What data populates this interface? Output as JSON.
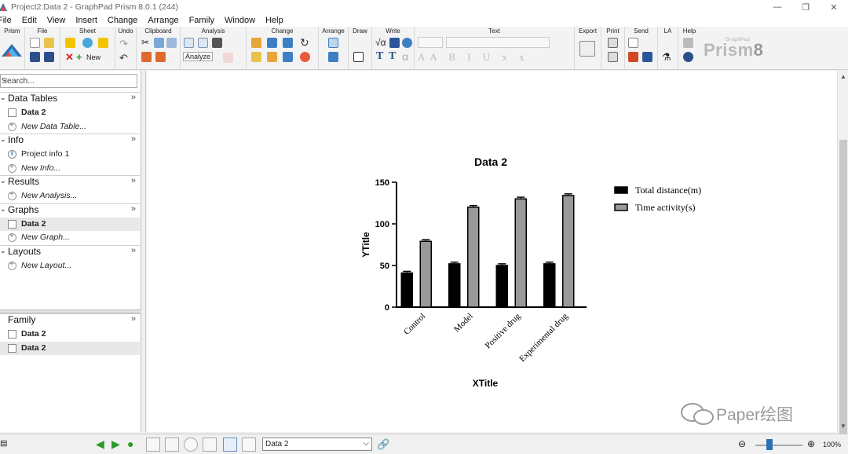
{
  "window": {
    "title": "Project2:Data 2 - GraphPad Prism 8.0.1 (244)",
    "minimize": "—",
    "restore": "❐",
    "close": "✕"
  },
  "menu": [
    "File",
    "Edit",
    "View",
    "Insert",
    "Change",
    "Arrange",
    "Family",
    "Window",
    "Help"
  ],
  "ribbon": {
    "groups": [
      "Prism",
      "File",
      "Sheet",
      "Undo",
      "Clipboard",
      "Analysis",
      "Change",
      "Arrange",
      "Draw",
      "Write",
      "Text",
      "Export",
      "Print",
      "Send",
      "LA",
      "Help"
    ],
    "new_label": "New",
    "analyze_label": "Analyze",
    "logo": "Prism",
    "logo_version": "8",
    "logo_small": "GraphPad"
  },
  "navigator": {
    "search_placeholder": "Search...",
    "sections": [
      {
        "name": "Data Tables",
        "items": [
          {
            "label": "Data 2",
            "bold": true
          },
          {
            "label": "New Data Table...",
            "new": true
          }
        ]
      },
      {
        "name": "Info",
        "items": [
          {
            "label": "Project info 1"
          },
          {
            "label": "New Info...",
            "new": true
          }
        ]
      },
      {
        "name": "Results",
        "items": [
          {
            "label": "New Analysis...",
            "new": true
          }
        ]
      },
      {
        "name": "Graphs",
        "items": [
          {
            "label": "Data 2",
            "bold": true,
            "selected": true
          },
          {
            "label": "New Graph...",
            "new": true
          }
        ]
      },
      {
        "name": "Layouts",
        "items": [
          {
            "label": "New Layout...",
            "new": true
          }
        ]
      }
    ],
    "family": {
      "name": "Family",
      "items": [
        {
          "label": "Data 2"
        },
        {
          "label": "Data 2",
          "selected": true
        }
      ]
    },
    "more": "»"
  },
  "status": {
    "sheet_value": "Data 2",
    "zoom": "100%"
  },
  "watermark": "Paper绘图",
  "colors": {
    "bar_total": "#000000",
    "bar_time": "#999999",
    "accent": "#2d6fb5"
  },
  "chart_data": {
    "type": "bar",
    "title": "Data 2",
    "xlabel": "XTitle",
    "ylabel": "YTitle",
    "ylim": [
      0,
      150
    ],
    "yticks": [
      0,
      50,
      100,
      150
    ],
    "categories": [
      "Control",
      "Model",
      "Positive drug",
      "Experimental drug"
    ],
    "series": [
      {
        "name": "Total distance(m)",
        "values": [
          41,
          52,
          50,
          52
        ],
        "errors": [
          2,
          2,
          2,
          2
        ]
      },
      {
        "name": "Time activity(s)",
        "values": [
          79,
          120,
          130,
          134
        ],
        "errors": [
          2,
          2,
          2,
          2
        ]
      }
    ],
    "legend": "right",
    "grid": false
  }
}
